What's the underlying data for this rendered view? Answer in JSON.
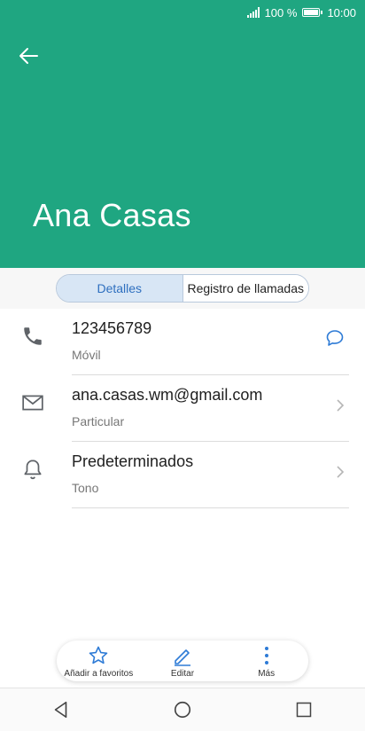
{
  "status": {
    "battery": "100 %",
    "time": "10:00"
  },
  "contact": {
    "name": "Ana Casas"
  },
  "tabs": [
    {
      "label": "Detalles",
      "active": true
    },
    {
      "label": "Registro de llamadas",
      "active": false
    }
  ],
  "details": [
    {
      "primary": "123456789",
      "secondary": "Móvil",
      "icon": "phone-icon",
      "action": "message-icon"
    },
    {
      "primary": "ana.casas.wm@gmail.com",
      "secondary": "Particular",
      "icon": "mail-icon",
      "action": "chevron-right-icon"
    },
    {
      "primary": "Predeterminados",
      "secondary": "Tono",
      "icon": "bell-icon",
      "action": "chevron-right-icon"
    }
  ],
  "bottom_bar": {
    "favorite_label": "Añadir a favoritos",
    "edit_label": "Editar",
    "more_label": "Más"
  },
  "colors": {
    "header": "#1fa681",
    "accent": "#2e7bd6"
  }
}
